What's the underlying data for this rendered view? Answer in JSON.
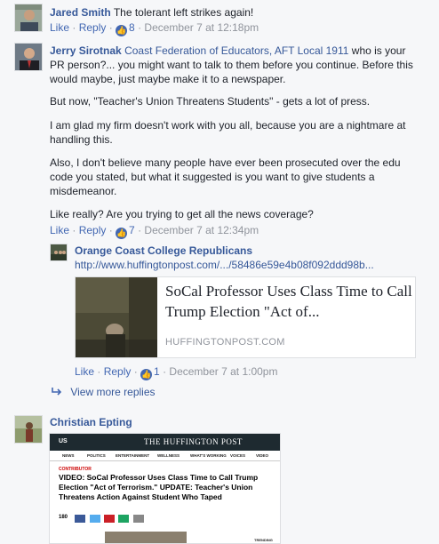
{
  "comments": {
    "c1": {
      "author": "Jared Smith",
      "text": "The tolerant left strikes again!",
      "like_label": "Like",
      "reply_label": "Reply",
      "reaction_count": "8",
      "timestamp": "December 7 at 12:18pm"
    },
    "c2": {
      "author": "Jerry Sirotnak",
      "line1_rest": "who is your",
      "tag": "Coast Federation of Educators, AFT Local 1911",
      "line2": "PR person?... you might want to talk to them before you continue. Before this",
      "line3": "would maybe, just maybe make it to a newspaper.",
      "p2": "But now, \"Teacher's Union Threatens Students\" - gets a lot of press.",
      "p3a": "I am glad my firm doesn't work with you all, because you are a nightmare at",
      "p3b": "handling this.",
      "p4a": "Also, I don't believe many people have ever been prosecuted over the edu",
      "p4b": "code you stated, but what it suggested is you want to give students a",
      "p4c": "misdemeanor.",
      "p5": "Like really? Are you trying to get all the news coverage?",
      "like_label": "Like",
      "reply_label": "Reply",
      "reaction_count": "7",
      "timestamp": "December 7 at 12:34pm"
    },
    "reply1": {
      "author": "Orange Coast College Republicans",
      "url": "http://www.huffingtonpost.com/.../58486e59e4b08f092ddd98b...",
      "card_title": "SoCal Professor Uses Class Time to Call Trump Election \"Act of...",
      "card_domain": "HUFFINGTONPOST.COM",
      "like_label": "Like",
      "reply_label": "Reply",
      "reaction_count": "1",
      "timestamp": "December 7 at 1:00pm"
    },
    "view_more": "View more replies",
    "c3": {
      "author": "Christian Epting",
      "screenshot": {
        "edition": "US",
        "logo": "THE HUFFINGTON POST",
        "nav": [
          "NEWS",
          "POLITICS",
          "ENTERTAINMENT",
          "WELLNESS",
          "WHAT'S WORKING",
          "VOICES",
          "VIDEO"
        ],
        "contributor": "CONTRIBUTOR",
        "headline": "VIDEO: SoCal Professor Uses Class Time to Call Trump Election \"Act of Terrorism.\" UPDATE: Teacher's Union Threatens Action Against Student Who Taped",
        "share_count": "180",
        "trending": "TRENDING"
      }
    }
  },
  "colors": {
    "link": "#365899",
    "action": "#4267b2",
    "meta": "#90949c",
    "background": "#f6f7f9"
  }
}
